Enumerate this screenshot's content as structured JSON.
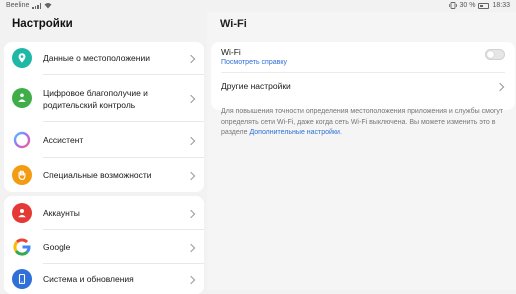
{
  "status_bar": {
    "carrier": "Beeline",
    "battery_percent": "30 %",
    "time": "18:33"
  },
  "left_panel": {
    "title": "Настройки",
    "items": [
      {
        "label": "Данные о местоположении",
        "icon": "location-pin-icon",
        "color": "#1fb8a6"
      },
      {
        "label": "Цифровое благополучие и родительский контроль",
        "icon": "digital-wellbeing-icon",
        "color": "#3fae49"
      },
      {
        "label": "Ассистент",
        "icon": "assistant-icon",
        "color": "#8a7cf0"
      },
      {
        "label": "Специальные возможности",
        "icon": "accessibility-hand-icon",
        "color": "#f39c12"
      },
      {
        "label": "Аккаунты",
        "icon": "account-icon",
        "color": "#e53935"
      },
      {
        "label": "Google",
        "icon": "google-icon",
        "color": "#4285f4"
      },
      {
        "label": "Система и обновления",
        "icon": "system-update-icon",
        "color": "#2f6fd8"
      }
    ]
  },
  "right_panel": {
    "title": "Wi-Fi",
    "wifi_label": "Wi-Fi",
    "help_link": "Посмотреть справку",
    "toggle_state": "off",
    "other_settings": "Другие настройки",
    "description": "Для повышения точности определения местоположения приложения и службы смогут определять сети Wi-Fi, даже когда сеть Wi-Fi выключена. Вы можете изменить это в разделе ",
    "description_link": "Дополнительные настройки",
    "description_end": "."
  }
}
